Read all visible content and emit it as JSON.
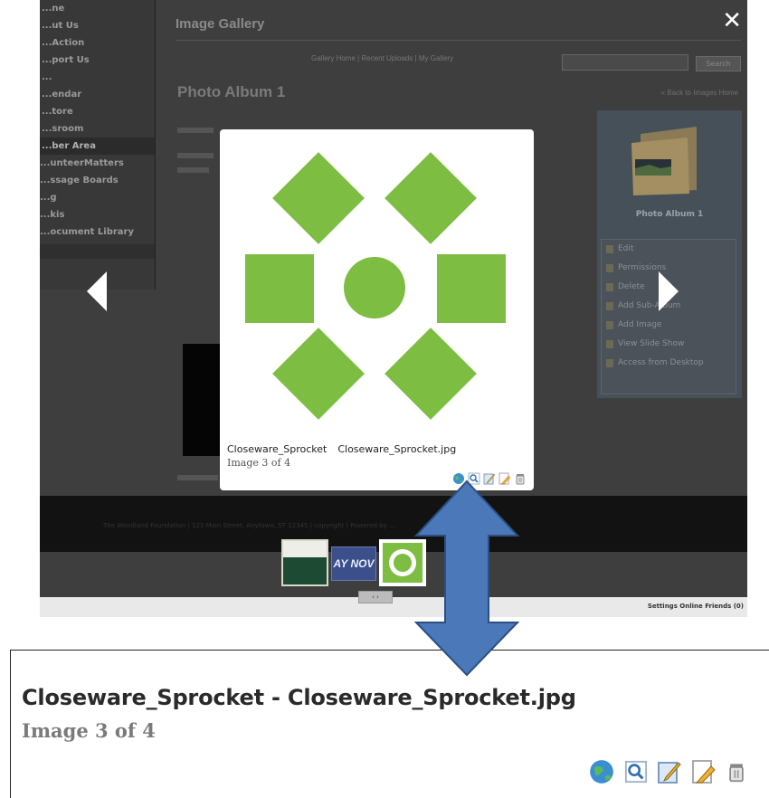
{
  "background_page": {
    "gallery_title": "Image Gallery",
    "album_title": "Photo Album 1",
    "toolbar_links": "Gallery Home | Recent Uploads | My Gallery",
    "search_button": "Search",
    "back_link": "« Back to Images Home",
    "sidebar_items": [
      "...ne",
      "...ut Us",
      "...Action",
      "...port Us",
      "...",
      "...endar",
      "...tore",
      "...sroom",
      "...ber Area",
      "...unteerMatters",
      "...ssage Boards",
      "...g",
      "...kis",
      "...ocument Library"
    ],
    "panel_album_label": "Photo Album 1",
    "panel_menu": [
      "Edit",
      "Permissions",
      "Delete",
      "Add Sub-Album",
      "Add Image",
      "View Slide Show",
      "Access from Desktop"
    ],
    "pager": "‹ ›",
    "settings": "Settings   Online Friends (0)",
    "footer": "The Woodland Foundation | 123 Main Street, Anytown, ST 12345 | copyright | Powered by ..."
  },
  "lightbox": {
    "close_label": "✕",
    "image_title": "Closeware_Sprocket",
    "image_filename": "Closeware_Sprocket.jpg",
    "counter": "Image 3 of 4",
    "tools": [
      "globe-icon",
      "magnifier-icon",
      "edit-icon",
      "pencil-icon",
      "trash-icon"
    ],
    "thumbnail_2_text": "AY NOV"
  },
  "zoomed_caption": {
    "title": "Closeware_Sprocket - Closeware_Sprocket.jpg",
    "counter": "Image 3 of 4",
    "tools": [
      "globe-icon",
      "magnifier-icon",
      "edit-icon",
      "pencil-icon",
      "trash-icon"
    ]
  },
  "colors": {
    "sprocket_green": "#7dbd42",
    "arrow_blue": "#4a78b9",
    "arrow_outline": "#2d4f80",
    "overlay_gray": "#3e3e3e"
  }
}
